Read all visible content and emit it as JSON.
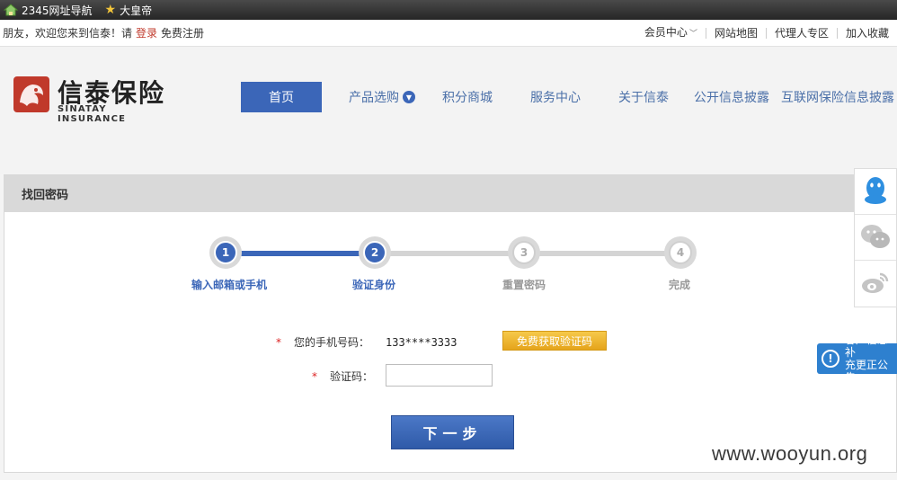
{
  "bookmarks": [
    {
      "label": "2345网址导航",
      "icon": "house-icon"
    },
    {
      "label": "大皇帝",
      "icon": "star-icon"
    }
  ],
  "topbar": {
    "welcome": "朋友，欢迎您来到信泰！请",
    "login": "登录",
    "register": "免费注册",
    "links": [
      "会员中心",
      "网站地图",
      "代理人专区",
      "加入收藏"
    ]
  },
  "logo": {
    "cn": "信泰保险",
    "en": "SINATAY INSURANCE",
    "brand_color": "#c0392b"
  },
  "nav": {
    "items": [
      "首页",
      "产品选购",
      "积分商城",
      "服务中心",
      "关于信泰",
      "公开信息披露",
      "互联网保险信息披露"
    ],
    "active_color": "#3b66b8"
  },
  "panel": {
    "title": "找回密码"
  },
  "steps": [
    {
      "num": "1",
      "label": "输入邮箱或手机",
      "state": "done"
    },
    {
      "num": "2",
      "label": "验证身份",
      "state": "current"
    },
    {
      "num": "3",
      "label": "重置密码",
      "state": "pending"
    },
    {
      "num": "4",
      "label": "完成",
      "state": "pending"
    }
  ],
  "form": {
    "required_mark": "*",
    "phone_label": "您的手机号码：",
    "phone_value": "133****3333",
    "get_code_button": "免费获取验证码",
    "code_label": "验证码：",
    "code_value": "",
    "next_button": "下一步"
  },
  "side": {
    "buttons": [
      "qq-icon",
      "wechat-icon",
      "weibo-icon"
    ]
  },
  "notice": {
    "line1": "客户信息补",
    "line2": "充更正公告"
  },
  "watermark": "www.wooyun.org"
}
